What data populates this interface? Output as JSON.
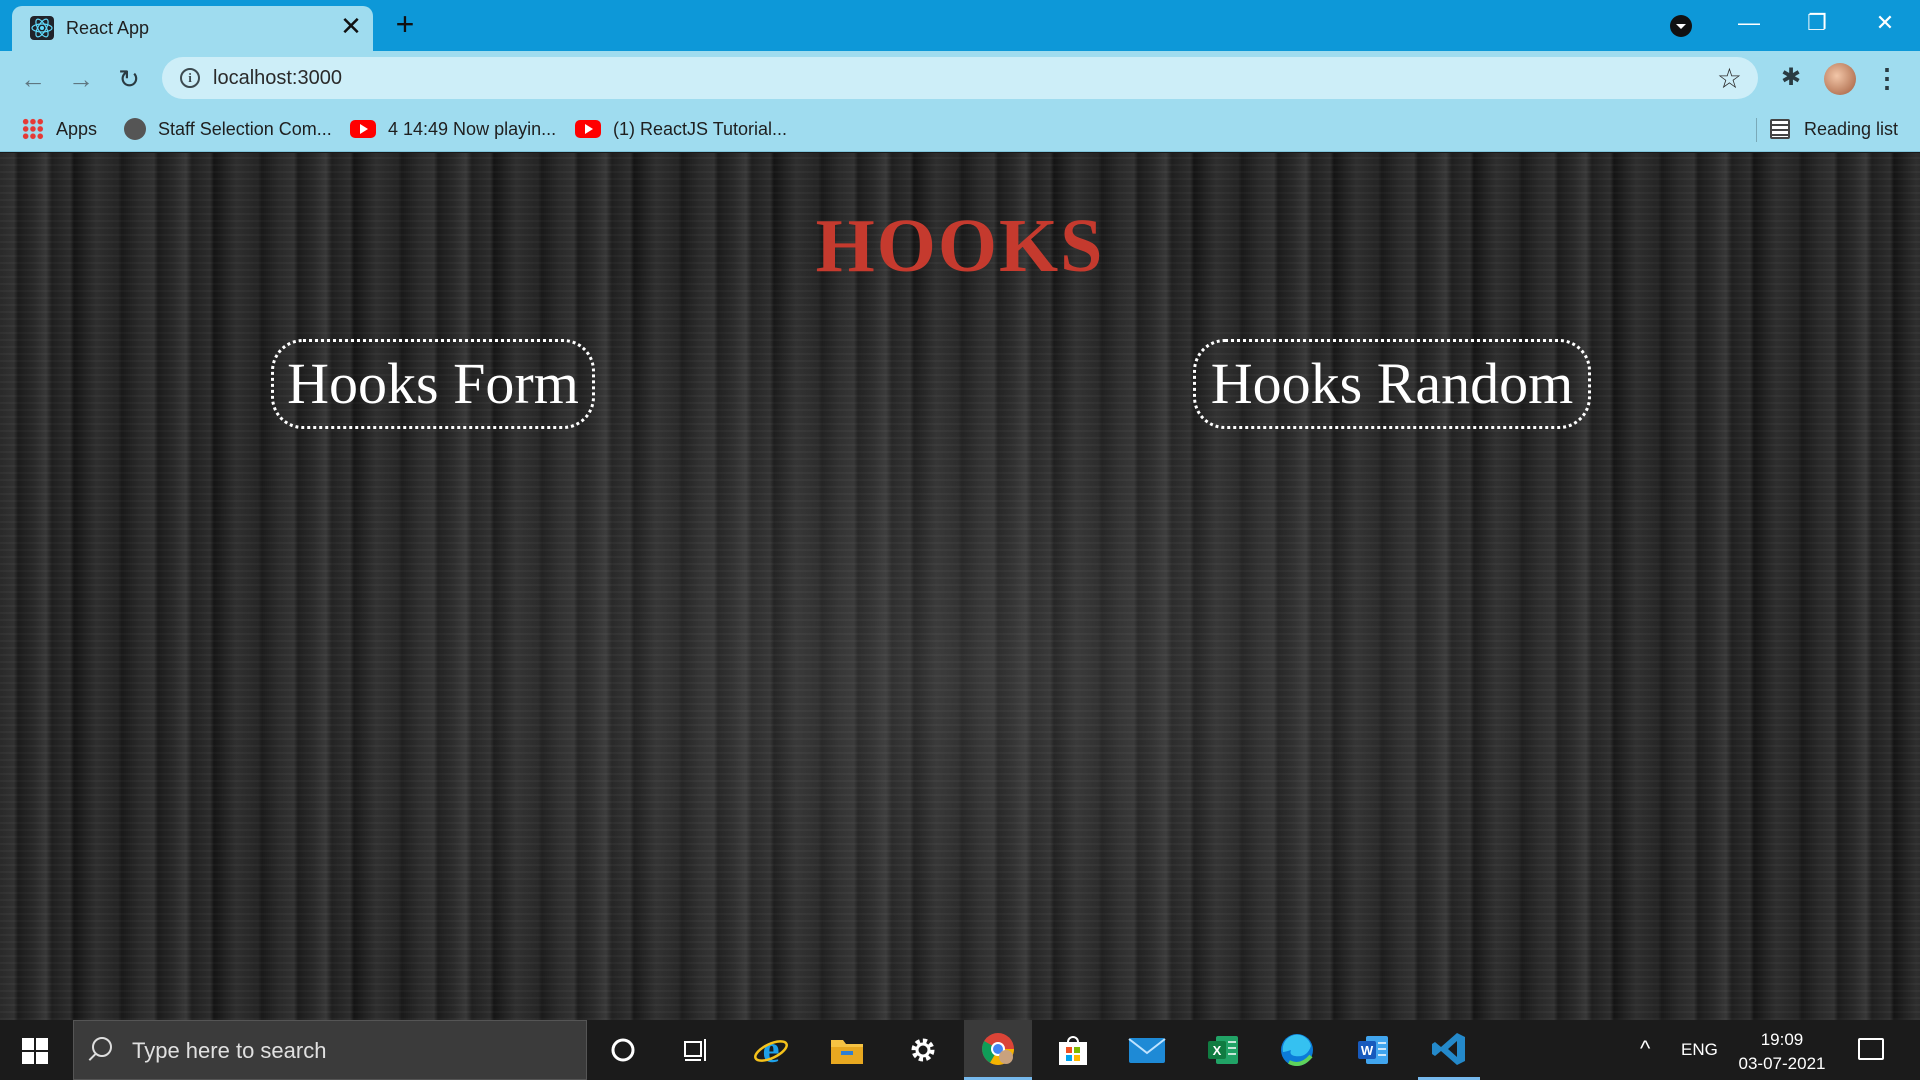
{
  "browser": {
    "tab": {
      "title": "React App",
      "close_glyph": "✕"
    },
    "new_tab_glyph": "+",
    "window_controls": {
      "minimize": "—",
      "restore": "❐",
      "close": "✕"
    },
    "nav": {
      "back": "←",
      "forward": "→",
      "reload": "↻"
    },
    "address": {
      "url": "localhost:3000",
      "info_glyph": "i",
      "star_glyph": "☆"
    },
    "extensions_glyph": "✱",
    "menu_glyph": "⋮",
    "bookmarks": [
      {
        "label": "Apps",
        "icon": "apps-grid-icon"
      },
      {
        "label": "Staff Selection Com...",
        "icon": "globe-icon"
      },
      {
        "label": "4 14:49 Now playin...",
        "icon": "youtube-icon"
      },
      {
        "label": "(1) ReactJS Tutorial...",
        "icon": "youtube-icon"
      }
    ],
    "reading_list": "Reading list"
  },
  "page": {
    "heading": "HOOKS",
    "links": [
      {
        "label": "Hooks Form"
      },
      {
        "label": "Hooks Random"
      }
    ],
    "heading_color": "#c53a2e"
  },
  "taskbar": {
    "search_placeholder": "Type here to search",
    "apps": [
      "cortana-icon",
      "task-view-icon",
      "internet-explorer-icon",
      "file-explorer-icon",
      "settings-icon",
      "chrome-icon",
      "store-icon",
      "mail-icon",
      "excel-icon",
      "edge-icon",
      "word-icon",
      "vscode-icon"
    ],
    "tray": {
      "chevron": "^",
      "language": "ENG",
      "time": "19:09",
      "date": "03-07-2021"
    }
  }
}
